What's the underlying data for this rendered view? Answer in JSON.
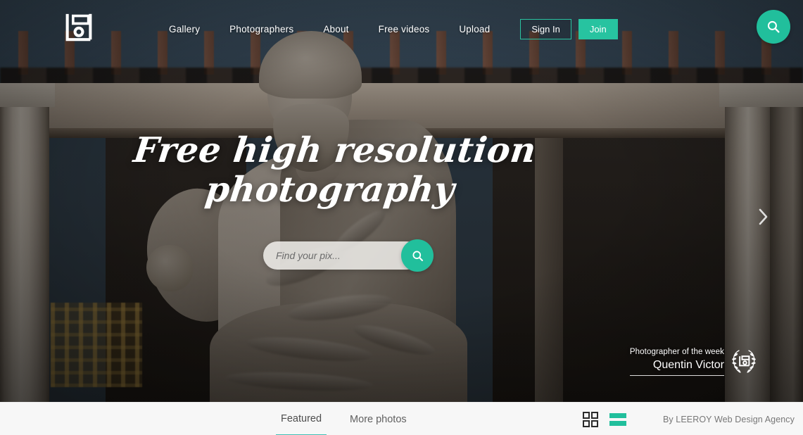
{
  "brand": {
    "logo_icon": "camera-floppy-logo-icon",
    "accent_color": "#27c3a0",
    "accent_alt_color": "#3fc0b6"
  },
  "nav": {
    "links": [
      {
        "label": "Gallery",
        "name": "nav-link-gallery"
      },
      {
        "label": "Photographers",
        "name": "nav-link-photographers"
      },
      {
        "label": "About",
        "name": "nav-link-about"
      },
      {
        "label": "Free videos",
        "name": "nav-link-free-videos"
      },
      {
        "label": "Upload",
        "name": "nav-link-upload"
      }
    ],
    "sign_in_label": "Sign In",
    "join_label": "Join",
    "search_fab_icon": "search-icon"
  },
  "hero": {
    "headline_line1": "Free high resolution",
    "headline_line2": "photography",
    "search": {
      "placeholder": "Find your pix...",
      "value": "",
      "button_icon": "search-icon"
    },
    "carousel_next_icon": "chevron-right-icon",
    "photographer_of_week": {
      "label": "Photographer of the week",
      "name": "Quentin Victor",
      "badge_icon": "laurel-wreath-award-icon"
    }
  },
  "bottom_bar": {
    "tabs": [
      {
        "label": "Featured",
        "active": true
      },
      {
        "label": "More photos",
        "active": false
      }
    ],
    "view_toggle": {
      "grid_icon": "grid-view-icon",
      "list_icon": "list-view-icon",
      "active": "list"
    },
    "credit": "By LEEROY Web Design Agency"
  }
}
